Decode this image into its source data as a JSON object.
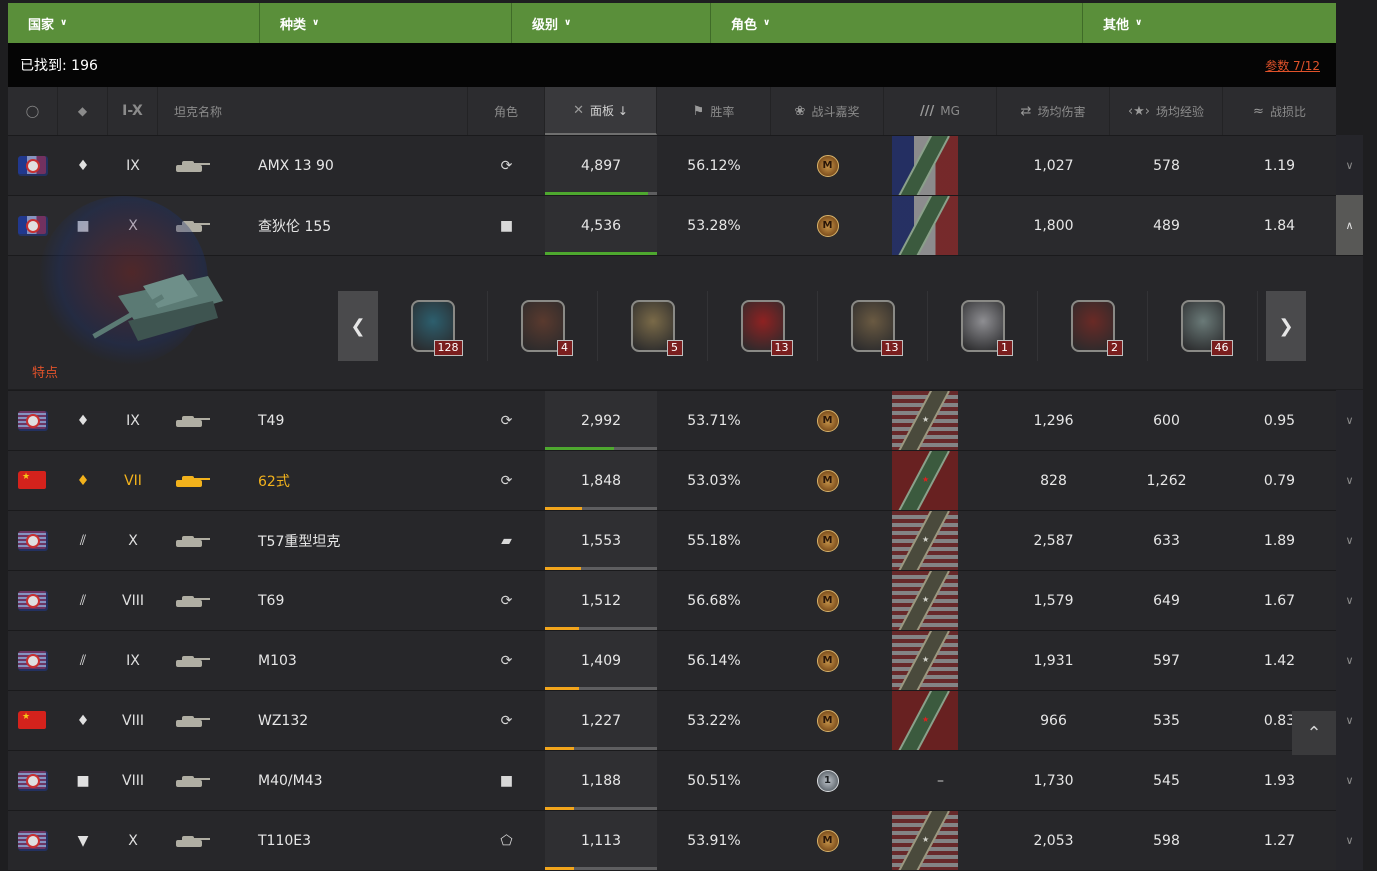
{
  "filters": [
    {
      "label": "国家"
    },
    {
      "label": "种类"
    },
    {
      "label": "级别"
    },
    {
      "label": "角色"
    },
    {
      "label": "其他"
    }
  ],
  "found": {
    "label": "已找到: 196",
    "params": "参数 7/12"
  },
  "columns": {
    "nation_icon": "globe-icon",
    "type_icon": "tank-type-icon",
    "tier": "I-X",
    "name": "坦克名称",
    "role": "角色",
    "panel": "面板 ↓",
    "winrate": "胜率",
    "mastery": "战斗嘉奖",
    "mg": "MG",
    "dmg": "场均伤害",
    "exp": "场均经验",
    "ratio": "战损比"
  },
  "rows": [
    {
      "nation": "fr",
      "type": "♦",
      "tier": "IX",
      "name": "AMX 13 90",
      "role": "⟳",
      "panel": "4,897",
      "panel_fill": 0.92,
      "panel_color": "green",
      "wr": "56.12%",
      "medal": "M",
      "mg": "fr-green",
      "dmg": "1,027",
      "exp": "578",
      "ratio": "1.19",
      "gold": false
    },
    {
      "nation": "fr",
      "type": "■",
      "tier": "X",
      "name": "查狄伦 155",
      "role": "■",
      "panel": "4,536",
      "panel_fill": 1.0,
      "panel_color": "green",
      "wr": "53.28%",
      "medal": "M",
      "mg": "fr-green",
      "dmg": "1,800",
      "exp": "489",
      "ratio": "1.84",
      "gold": false,
      "expanded": true
    },
    {
      "nation": "us",
      "type": "♦",
      "tier": "IX",
      "name": "T49",
      "role": "⟳",
      "panel": "2,992",
      "panel_fill": 0.62,
      "panel_color": "green",
      "wr": "53.71%",
      "medal": "M",
      "mg": "us-tan",
      "dmg": "1,296",
      "exp": "600",
      "ratio": "0.95",
      "gold": false
    },
    {
      "nation": "cn",
      "type": "♦",
      "tier": "VII",
      "name": "62式",
      "role": "⟳",
      "panel": "1,848",
      "panel_fill": 0.33,
      "panel_color": "orange",
      "wr": "53.03%",
      "medal": "M",
      "mg": "cn-green",
      "dmg": "828",
      "exp": "1,262",
      "ratio": "0.79",
      "gold": true
    },
    {
      "nation": "us",
      "type": "⫽",
      "tier": "X",
      "name": "T57重型坦克",
      "role": "▰",
      "panel": "1,553",
      "panel_fill": 0.32,
      "panel_color": "orange",
      "wr": "55.18%",
      "medal": "M",
      "mg": "us-tan",
      "dmg": "2,587",
      "exp": "633",
      "ratio": "1.89",
      "gold": false
    },
    {
      "nation": "us",
      "type": "⫽",
      "tier": "VIII",
      "name": "T69",
      "role": "⟳",
      "panel": "1,512",
      "panel_fill": 0.3,
      "panel_color": "orange",
      "wr": "56.68%",
      "medal": "M",
      "mg": "us-tan",
      "dmg": "1,579",
      "exp": "649",
      "ratio": "1.67",
      "gold": false
    },
    {
      "nation": "us",
      "type": "⫽",
      "tier": "IX",
      "name": "M103",
      "role": "⟳",
      "panel": "1,409",
      "panel_fill": 0.3,
      "panel_color": "orange",
      "wr": "56.14%",
      "medal": "M",
      "mg": "us-tan",
      "dmg": "1,931",
      "exp": "597",
      "ratio": "1.42",
      "gold": false
    },
    {
      "nation": "cn",
      "type": "♦",
      "tier": "VIII",
      "name": "WZ132",
      "role": "⟳",
      "panel": "1,227",
      "panel_fill": 0.26,
      "panel_color": "orange",
      "wr": "53.22%",
      "medal": "M",
      "mg": "cn-green",
      "dmg": "966",
      "exp": "535",
      "ratio": "0.83",
      "gold": false
    },
    {
      "nation": "us",
      "type": "■",
      "tier": "VIII",
      "name": "M40/M43",
      "role": "■",
      "panel": "1,188",
      "panel_fill": 0.26,
      "panel_color": "orange",
      "wr": "50.51%",
      "medal": "1",
      "mg": "none",
      "dmg": "1,730",
      "exp": "545",
      "ratio": "1.93",
      "gold": false
    },
    {
      "nation": "us",
      "type": "▼",
      "tier": "X",
      "name": "T110E3",
      "role": "⬠",
      "panel": "1,113",
      "panel_fill": 0.26,
      "panel_color": "orange",
      "wr": "53.91%",
      "medal": "M",
      "mg": "us-tan",
      "dmg": "2,053",
      "exp": "598",
      "ratio": "1.27",
      "gold": false
    }
  ],
  "detail": {
    "feature": "特点",
    "achievements": [
      {
        "count": "128",
        "color": "#2d5f6e"
      },
      {
        "count": "4",
        "color": "#5a3a2e"
      },
      {
        "count": "5",
        "color": "#7a6a48"
      },
      {
        "count": "13",
        "color": "#8e2222"
      },
      {
        "count": "13",
        "color": "#6a5a42"
      },
      {
        "count": "1",
        "color": "#8e8e92"
      },
      {
        "count": "2",
        "color": "#6a2a26"
      },
      {
        "count": "46",
        "color": "#6a7a78"
      }
    ],
    "mg_empty": "–"
  },
  "colors": {
    "filter_green": "#5a8f3a",
    "gold": "#f2b21c",
    "bar_orange": "#f2a51c",
    "bar_green": "#4ea82f",
    "accent_red": "#e0522a"
  }
}
